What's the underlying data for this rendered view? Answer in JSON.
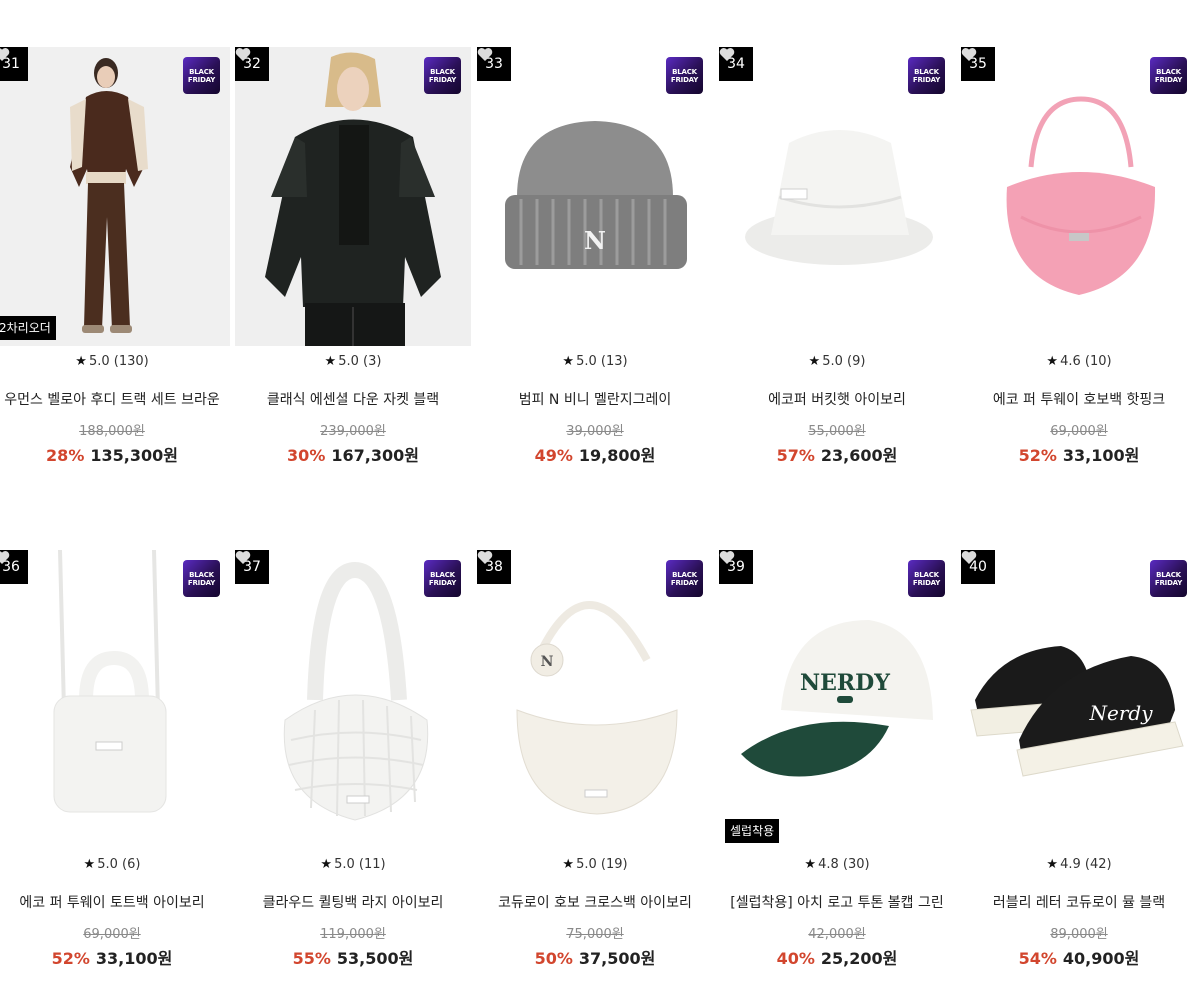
{
  "badge": {
    "line1": "BLACK",
    "line2": "FRIDAY"
  },
  "colors": {
    "discount": "#d2462e",
    "rank_bg": "#000000",
    "badge_gradient": [
      "#5a2bc2",
      "#14062d"
    ]
  },
  "products": [
    {
      "rank": "31",
      "rating": "5.0 (130)",
      "name": "우먼스 벨로아 후디 트랙 세트 브라운",
      "orig_price": "188,000원",
      "discount": "28%",
      "sale_price": "135,300원",
      "tag": "2차리오더",
      "image": "brown-velour-tracksuit-model"
    },
    {
      "rank": "32",
      "rating": "5.0 (3)",
      "name": "클래식 에센셜 다운 자켓 블랙",
      "orig_price": "239,000원",
      "discount": "30%",
      "sale_price": "167,300원",
      "tag": "",
      "image": "black-puffer-jacket-model"
    },
    {
      "rank": "33",
      "rating": "5.0 (13)",
      "name": "범피 N 비니 멜란지그레이",
      "orig_price": "39,000원",
      "discount": "49%",
      "sale_price": "19,800원",
      "tag": "",
      "image": "grey-beanie"
    },
    {
      "rank": "34",
      "rating": "5.0 (9)",
      "name": "에코퍼 버킷햇 아이보리",
      "orig_price": "55,000원",
      "discount": "57%",
      "sale_price": "23,600원",
      "tag": "",
      "image": "ivory-fur-bucket-hat"
    },
    {
      "rank": "35",
      "rating": "4.6 (10)",
      "name": "에코 퍼 투웨이 호보백 핫핑크",
      "orig_price": "69,000원",
      "discount": "52%",
      "sale_price": "33,100원",
      "tag": "",
      "image": "pink-fur-hobo-bag"
    },
    {
      "rank": "36",
      "rating": "5.0 (6)",
      "name": "에코 퍼 투웨이 토트백 아이보리",
      "orig_price": "69,000원",
      "discount": "52%",
      "sale_price": "33,100원",
      "tag": "",
      "image": "ivory-fur-tote-bag"
    },
    {
      "rank": "37",
      "rating": "5.0 (11)",
      "name": "클라우드 퀼팅백 라지 아이보리",
      "orig_price": "119,000원",
      "discount": "55%",
      "sale_price": "53,500원",
      "tag": "",
      "image": "ivory-quilted-bag"
    },
    {
      "rank": "38",
      "rating": "5.0 (19)",
      "name": "코듀로이 호보 크로스백 아이보리",
      "orig_price": "75,000원",
      "discount": "50%",
      "sale_price": "37,500원",
      "tag": "",
      "image": "ivory-corduroy-crossbag"
    },
    {
      "rank": "39",
      "rating": "4.8 (30)",
      "name": "[셀럽착용] 아치 로고 투톤 볼캡 그린",
      "orig_price": "42,000원",
      "discount": "40%",
      "sale_price": "25,200원",
      "tag": "셀럽착용",
      "image": "green-two-tone-ballcap",
      "cap_logo": "NERDY"
    },
    {
      "rank": "40",
      "rating": "4.9 (42)",
      "name": "러블리 레터 코듀로이 뮬 블랙",
      "orig_price": "89,000원",
      "discount": "54%",
      "sale_price": "40,900원",
      "tag": "",
      "image": "black-corduroy-mule",
      "mule_script": "Nerdy"
    }
  ]
}
